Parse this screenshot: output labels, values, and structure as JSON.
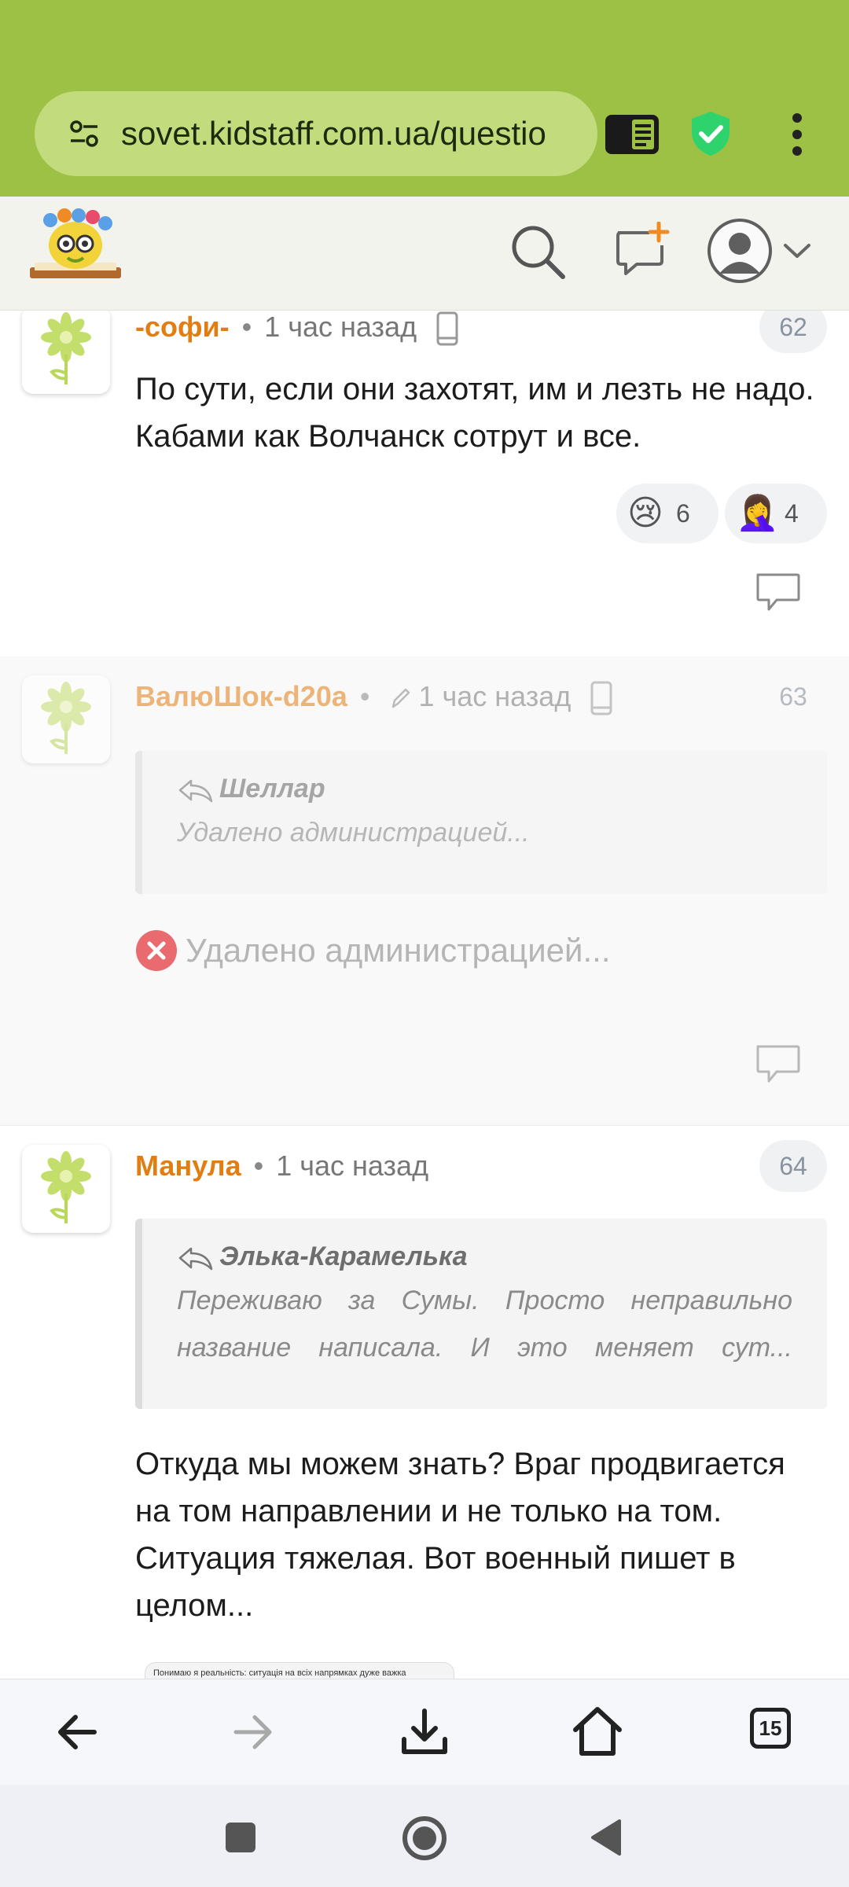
{
  "browser": {
    "url": "sovet.kidstaff.com.ua/questio",
    "tab_count": "15"
  },
  "colors": {
    "chrome_green": "#9dc145",
    "author_orange": "#e27d12",
    "shield_green": "#2fd36e"
  },
  "comments": [
    {
      "author": "-софи-",
      "time": "1 час назад",
      "number": "62",
      "text": "По сути, если они захотят, им и лезть не надо. Кабами как Волчанск сотрут и все.",
      "reactions": [
        {
          "emoji": "😢",
          "count": "6"
        },
        {
          "emoji": "🤦‍♀️",
          "count": "4"
        }
      ]
    },
    {
      "author": "ВалюШок-d20a",
      "time": "1 час назад",
      "number": "63",
      "quote_author": "Шеллар",
      "quote_text": "Удалено администрацией...",
      "deleted_text": "Удалено администрацией..."
    },
    {
      "author": "Манула",
      "time": "1 час назад",
      "number": "64",
      "quote_author": "Элька-Карамелька",
      "quote_text": "Переживаю за Сумы. Просто неправильно название написала. И это меняет сут...",
      "text": "Откуда мы можем знать? Враг продвигается на том направлении и не только на том. Ситуация тяжелая. Вот военный пишет в целом...",
      "embedded_preview": "Понимаю я реальність: ситуація на всіх напрямках дуже важка"
    }
  ]
}
